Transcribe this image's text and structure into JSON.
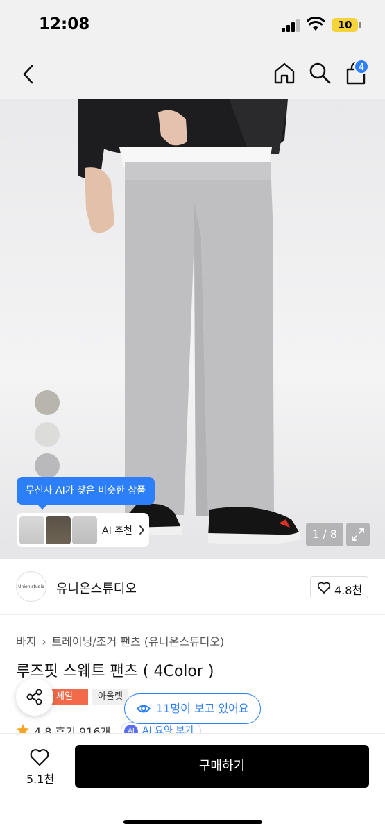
{
  "status_bar": {
    "time": "12:08",
    "battery": "10"
  },
  "nav": {
    "cart_count": "4"
  },
  "gallery": {
    "ai_tooltip": "무신사 AI가 찾은 비슷한 상품",
    "ai_reco_label": "AI 추천",
    "page_indicator": "1 / 8",
    "color_swatches": [
      "#b7b5ac",
      "#dcdcdb",
      "#b9b9bb",
      "#3a3a3a"
    ]
  },
  "brand": {
    "logo_text": "Union studio",
    "name": "유니온스튜디오",
    "likes": "4.8천"
  },
  "product": {
    "breadcrumb": [
      "바지",
      "트레이닝/조거 팬츠 (유니온스튜디오)"
    ],
    "title": "루즈핏 스웨트 팬츠 ( 4Color )",
    "tags": {
      "sale": "세일",
      "outlet": "아울렛"
    },
    "viewers": "11명이 보고 있어요",
    "rating": "4.8  후기 916개",
    "ai_summary": "AI 요약 보기",
    "ai_badge": "AI"
  },
  "bottom": {
    "wish_count": "5.1천",
    "buy_label": "구매하기"
  },
  "colors": {
    "accent": "#2d7ff9",
    "sale": "#f26a4a",
    "buy_button": "#000000"
  }
}
